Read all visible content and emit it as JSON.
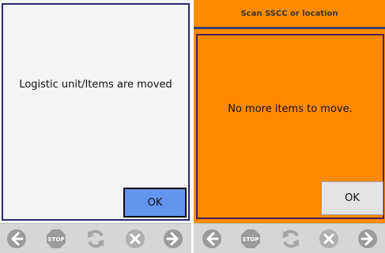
{
  "left_screen": {
    "message": "Logistic unit/Items are moved",
    "ok_label": "OK"
  },
  "right_screen": {
    "title": "Scan SSCC or location",
    "message": "No more items to move.",
    "ok_label": "OK"
  },
  "toolbar": {
    "icons": [
      "arrow-left-icon",
      "stop-icon",
      "refresh-icon",
      "cancel-icon",
      "arrow-right-icon"
    ],
    "stop_label": "STOP"
  }
}
